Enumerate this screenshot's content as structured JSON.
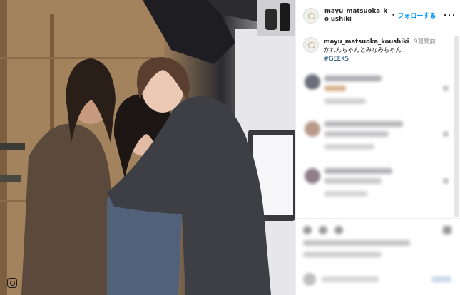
{
  "post": {
    "username": "mayu_matsuoka_koushiki",
    "username_display": "mayu_matsuoka_ko ushiki",
    "follow_separator": "•",
    "follow_label": "フォローする"
  },
  "caption": {
    "username": "mayu_matsuoka_koushiki",
    "time": "9週間前",
    "text": "かれんちゃんとみなみちゃん",
    "hashtag": "#GEEKS"
  },
  "icons": {
    "more": "more-horizontal-icon",
    "instagram": "instagram-glyph-icon"
  },
  "colors": {
    "follow": "#0095f6",
    "hashtag": "#00376b",
    "muted": "#8e8e8e"
  }
}
